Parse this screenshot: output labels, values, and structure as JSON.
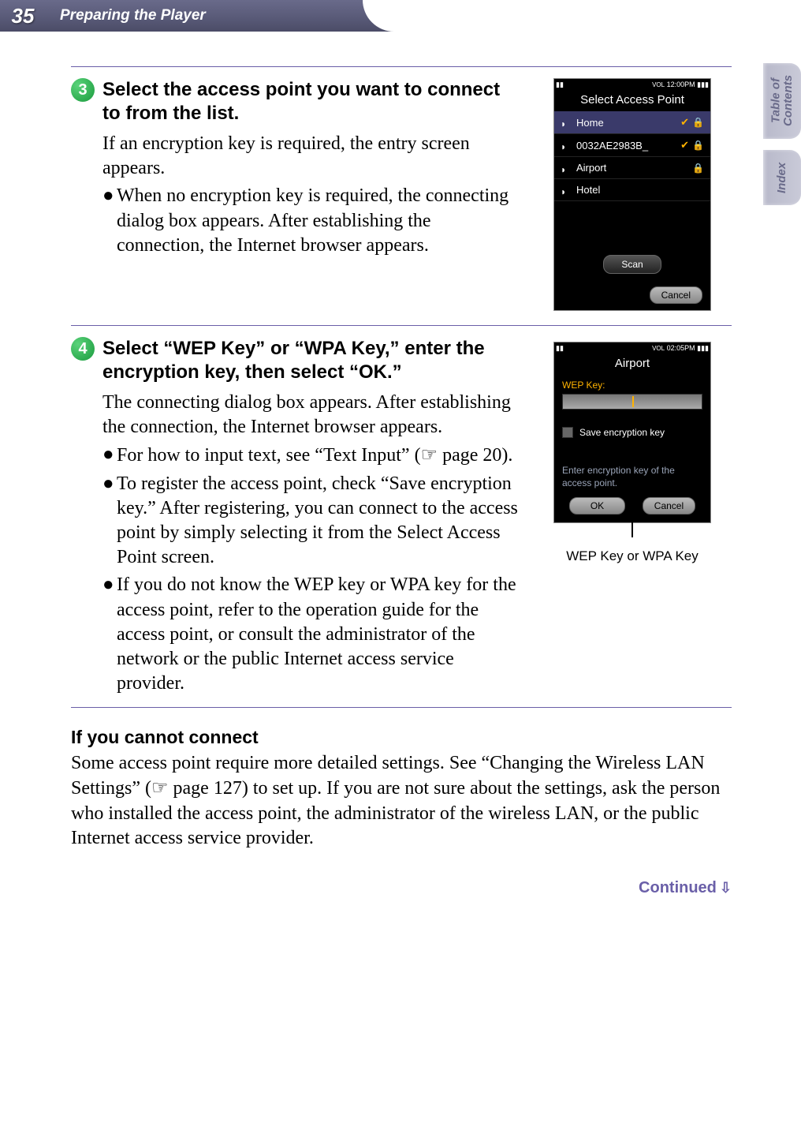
{
  "page_number": "35",
  "header_title": "Preparing the Player",
  "side_tabs": [
    "Table of\nContents",
    "Index"
  ],
  "step3": {
    "num": "3",
    "title": "Select the access point you want to connect to from the list.",
    "intro": "If an encryption key is required, the entry screen appears.",
    "bullet1": "When no encryption key is required, the connecting dialog box appears. After establishing the connection, the Internet browser appears."
  },
  "step4": {
    "num": "4",
    "title": "Select “WEP Key” or “WPA Key,” enter the encryption key, then select “OK.”",
    "intro": "The connecting dialog box appears. After establishing the connection, the Internet browser appears.",
    "bullet1_pre": "For how to input text, see “Text Input” (",
    "bullet1_post": " page 20).",
    "bullet2": "To register the access point, check “Save encryption key.” After registering, you can connect to the access point by simply selecting it from the Select Access Point screen.",
    "bullet3": "If you do not know the WEP key or WPA key for the access point, refer to the operation guide for the access point, or consult the administrator of the network or the public Internet access service provider."
  },
  "shot1": {
    "status_time": "12:00PM",
    "title": "Select Access Point",
    "rows": [
      {
        "name": "Home",
        "check": true,
        "lock": true
      },
      {
        "name": "0032AE2983B_",
        "check": true,
        "lock": true
      },
      {
        "name": "Airport",
        "check": false,
        "lock": true
      },
      {
        "name": "Hotel",
        "check": false,
        "lock": false
      }
    ],
    "scan": "Scan",
    "cancel": "Cancel"
  },
  "shot2": {
    "status_time": "02:05PM",
    "title": "Airport",
    "wep_label": "WEP Key:",
    "save_label": "Save encryption key",
    "enter_text": "Enter encryption key of the access point.",
    "ok": "OK",
    "cancel": "Cancel",
    "caption": "WEP Key or WPA Key"
  },
  "cannot": {
    "head": "If you cannot connect",
    "body_pre": "Some access point require more detailed settings. See “Changing the Wireless LAN Settings” (",
    "body_post": " page 127) to set up. If you are not sure about the settings, ask the person who installed the access point, the administrator of the wireless LAN, or the public Internet access service provider."
  },
  "continued": "Continued",
  "hand_glyph": "☞"
}
